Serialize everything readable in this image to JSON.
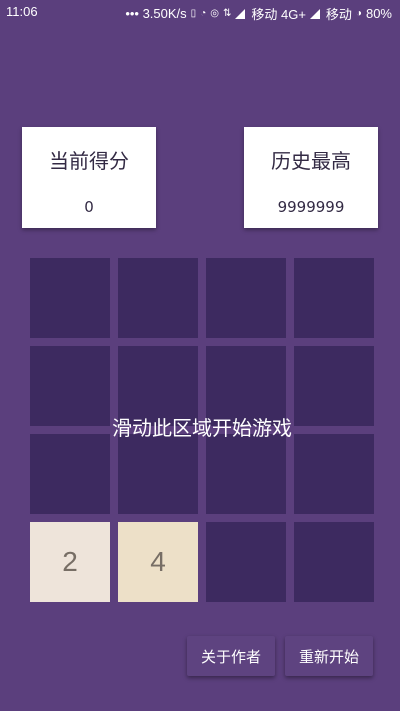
{
  "status_bar": {
    "time": "11:06",
    "speed": "••• 3.50K/s",
    "carrier1": "移动 4G+",
    "carrier2": "移动",
    "battery": "80%"
  },
  "scores": {
    "current_title": "当前得分",
    "current_value": "0",
    "best_title": "历史最高",
    "best_value": "9999999"
  },
  "board": {
    "hint": "滑动此区域开始游戏",
    "rows": [
      [
        "",
        "",
        "",
        ""
      ],
      [
        "",
        "",
        "",
        ""
      ],
      [
        "",
        "",
        "",
        ""
      ],
      [
        "2",
        "4",
        "",
        ""
      ]
    ]
  },
  "buttons": {
    "about": "关于作者",
    "restart": "重新开始"
  },
  "colors": {
    "background": "#5b3f7d",
    "empty_cell": "#3d2a60",
    "tile_2": "#eee4da",
    "tile_4": "#ede0c8"
  }
}
